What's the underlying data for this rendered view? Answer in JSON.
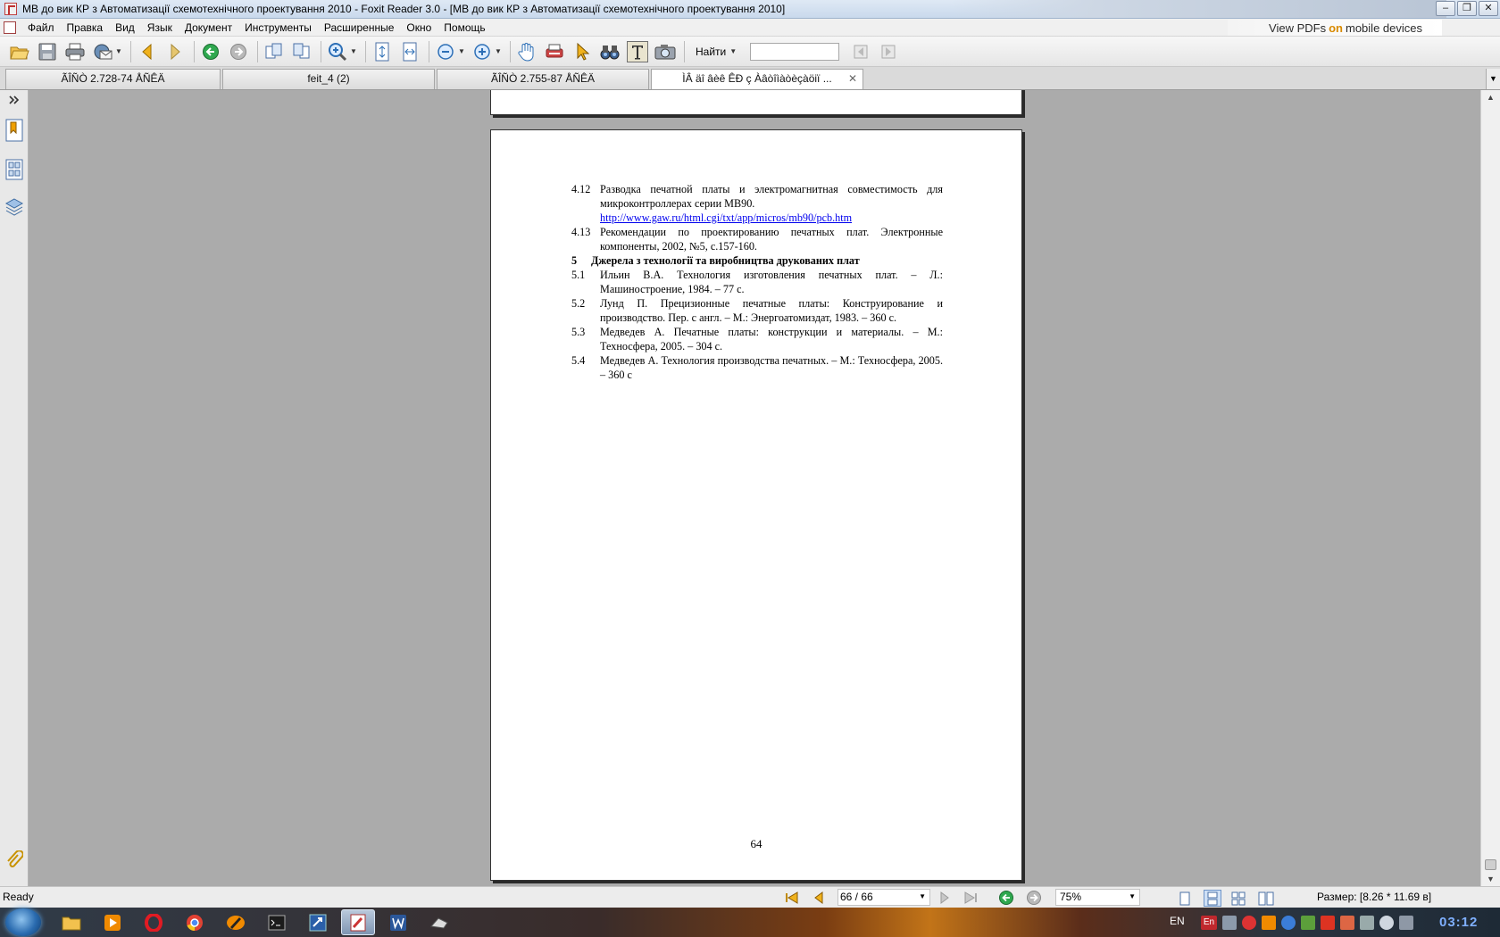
{
  "window": {
    "title": "МВ до вик КР з Автоматизації схемотехнічного проектування 2010 - Foxit Reader 3.0 - [МВ до вик КР з Автоматизації схемотехнічного проектування 2010]",
    "buttons": {
      "minimize": "–",
      "restore": "❐",
      "close": "✕"
    }
  },
  "menu": {
    "items": [
      "Файл",
      "Правка",
      "Вид",
      "Язык",
      "Документ",
      "Инструменты",
      "Расширенные",
      "Окно",
      "Помощь"
    ],
    "promo_prefix": "View PDFs",
    "promo_on": "on",
    "promo_suffix": "mobile devices"
  },
  "toolbar": {
    "find_label": "Найти",
    "find_value": "",
    "icons": [
      "open-icon",
      "save-icon",
      "print-icon",
      "email-icon",
      "prev-page-icon",
      "next-page-icon",
      "go-back-icon",
      "go-forward-icon",
      "rotate-left-icon",
      "rotate-right-icon",
      "zoom-in-icon",
      "fit-page-icon",
      "fit-width-icon",
      "zoom-out-minus-icon",
      "zoom-in-plus-icon",
      "hand-tool-icon",
      "typewriter-icon",
      "select-arrow-icon",
      "find-binoculars-icon",
      "text-select-icon",
      "snapshot-icon",
      "find-prev-icon",
      "find-next-icon"
    ]
  },
  "tabs": [
    {
      "label": "ÃÎÑÒ 2.728-74 ÅÑÊÄ",
      "active": false
    },
    {
      "label": "feit_4 (2)",
      "active": false
    },
    {
      "label": "ÃÎÑÒ 2.755-87 ÅÑÊÄ",
      "active": false
    },
    {
      "label": "ÌÂ äî âèê ÊÐ ç Àâòîìàòèçàöiï ...",
      "active": true,
      "close": "✕"
    }
  ],
  "document": {
    "refs_top": [
      {
        "num": "4.12",
        "text_before_link": "Разводка печатной платы и электромагнитная совместимость для микроконтроллерах серии МВ90.",
        "link": "http://www.gaw.ru/html.cgi/txt/app/micros/mb90/pcb.htm"
      },
      {
        "num": "4.13",
        "text": "Рекомендации по проектированию печатных плат. Электронные компоненты, 2002, №5, с.157-160."
      }
    ],
    "section": {
      "num": "5",
      "title": "Джерела з технології та виробництва друкованих плат"
    },
    "refs": [
      {
        "num": "5.1",
        "text": "Ильин В.А. Технология изготовления печатных плат. – Л.: Машиностроение, 1984. – 77 с."
      },
      {
        "num": "5.2",
        "text": "Лунд П. Прецизионные печатные платы: Конструирование и производство. Пер. с англ. – М.: Энергоатомиздат, 1983. – 360 с."
      },
      {
        "num": "5.3",
        "text": "Медведев А. Печатные платы: конструкции и материалы. – М.: Техносфера, 2005. – 304 с."
      },
      {
        "num": "5.4",
        "text": "Медведев А. Технология производства печатных. – М.: Техносфера, 2005. – 360 с"
      }
    ],
    "page_number": "64"
  },
  "status": {
    "ready": "Ready",
    "page_indicator": "66 / 66",
    "zoom": "75%",
    "size": "Размер: [8.26 * 11.69 в]"
  },
  "taskbar": {
    "lang": "EN",
    "tray_lang": "En",
    "clock": "03:12"
  },
  "colors": {
    "link": "#0000ee",
    "doc_background": "#ababab",
    "accent_find": "#d88a00"
  }
}
